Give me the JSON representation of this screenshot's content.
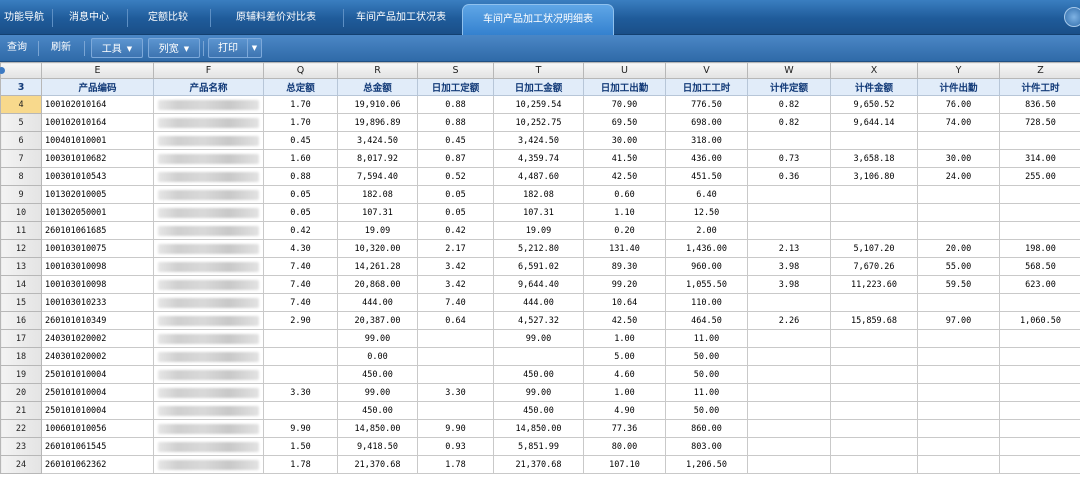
{
  "tabs": [
    {
      "label": "功能导航",
      "active": false
    },
    {
      "label": "消息中心",
      "active": false
    },
    {
      "label": "定额比较",
      "active": false
    },
    {
      "label": "原辅料差价对比表",
      "active": false
    },
    {
      "label": "车间产品加工状况表",
      "active": false
    },
    {
      "label": "车间产品加工状况明细表",
      "active": true
    }
  ],
  "toolbar": {
    "query_label": "查询",
    "refresh_label": "刷新",
    "tools_label": "工具",
    "colwidth_label": "列宽",
    "print_label": "打印"
  },
  "grid": {
    "column_letters": [
      "E",
      "F",
      "Q",
      "R",
      "S",
      "T",
      "U",
      "V",
      "W",
      "X",
      "Y",
      "Z"
    ],
    "header_row_number": "3",
    "headers": [
      "产品编码",
      "产品名称",
      "总定额",
      "总金额",
      "日加工定额",
      "日加工金额",
      "日加工出勤",
      "日加工工时",
      "计件定额",
      "计件金额",
      "计件出勤",
      "计件工时"
    ],
    "selected_row": "4",
    "rows": [
      {
        "n": "4",
        "code": "100102010164",
        "q": "1.70",
        "r": "19,910.06",
        "s": "0.88",
        "t": "10,259.54",
        "u": "70.90",
        "v": "776.50",
        "w": "0.82",
        "x": "9,650.52",
        "y": "76.00",
        "z": "836.50"
      },
      {
        "n": "5",
        "code": "100102010164",
        "q": "1.70",
        "r": "19,896.89",
        "s": "0.88",
        "t": "10,252.75",
        "u": "69.50",
        "v": "698.00",
        "w": "0.82",
        "x": "9,644.14",
        "y": "74.00",
        "z": "728.50"
      },
      {
        "n": "6",
        "code": "100401010001",
        "q": "0.45",
        "r": "3,424.50",
        "s": "0.45",
        "t": "3,424.50",
        "u": "30.00",
        "v": "318.00",
        "w": "",
        "x": "",
        "y": "",
        "z": ""
      },
      {
        "n": "7",
        "code": "100301010682",
        "q": "1.60",
        "r": "8,017.92",
        "s": "0.87",
        "t": "4,359.74",
        "u": "41.50",
        "v": "436.00",
        "w": "0.73",
        "x": "3,658.18",
        "y": "30.00",
        "z": "314.00"
      },
      {
        "n": "8",
        "code": "100301010543",
        "q": "0.88",
        "r": "7,594.40",
        "s": "0.52",
        "t": "4,487.60",
        "u": "42.50",
        "v": "451.50",
        "w": "0.36",
        "x": "3,106.80",
        "y": "24.00",
        "z": "255.00"
      },
      {
        "n": "9",
        "code": "101302010005",
        "q": "0.05",
        "r": "182.08",
        "s": "0.05",
        "t": "182.08",
        "u": "0.60",
        "v": "6.40",
        "w": "",
        "x": "",
        "y": "",
        "z": ""
      },
      {
        "n": "10",
        "code": "101302050001",
        "q": "0.05",
        "r": "107.31",
        "s": "0.05",
        "t": "107.31",
        "u": "1.10",
        "v": "12.50",
        "w": "",
        "x": "",
        "y": "",
        "z": ""
      },
      {
        "n": "11",
        "code": "260101061685",
        "q": "0.42",
        "r": "19.09",
        "s": "0.42",
        "t": "19.09",
        "u": "0.20",
        "v": "2.00",
        "w": "",
        "x": "",
        "y": "",
        "z": ""
      },
      {
        "n": "12",
        "code": "100103010075",
        "q": "4.30",
        "r": "10,320.00",
        "s": "2.17",
        "t": "5,212.80",
        "u": "131.40",
        "v": "1,436.00",
        "w": "2.13",
        "x": "5,107.20",
        "y": "20.00",
        "z": "198.00"
      },
      {
        "n": "13",
        "code": "100103010098",
        "q": "7.40",
        "r": "14,261.28",
        "s": "3.42",
        "t": "6,591.02",
        "u": "89.30",
        "v": "960.00",
        "w": "3.98",
        "x": "7,670.26",
        "y": "55.00",
        "z": "568.50"
      },
      {
        "n": "14",
        "code": "100103010098",
        "q": "7.40",
        "r": "20,868.00",
        "s": "3.42",
        "t": "9,644.40",
        "u": "99.20",
        "v": "1,055.50",
        "w": "3.98",
        "x": "11,223.60",
        "y": "59.50",
        "z": "623.00"
      },
      {
        "n": "15",
        "code": "100103010233",
        "q": "7.40",
        "r": "444.00",
        "s": "7.40",
        "t": "444.00",
        "u": "10.64",
        "v": "110.00",
        "w": "",
        "x": "",
        "y": "",
        "z": ""
      },
      {
        "n": "16",
        "code": "260101010349",
        "q": "2.90",
        "r": "20,387.00",
        "s": "0.64",
        "t": "4,527.32",
        "u": "42.50",
        "v": "464.50",
        "w": "2.26",
        "x": "15,859.68",
        "y": "97.00",
        "z": "1,060.50"
      },
      {
        "n": "17",
        "code": "240301020002",
        "q": "",
        "r": "99.00",
        "s": "",
        "t": "99.00",
        "u": "1.00",
        "v": "11.00",
        "w": "",
        "x": "",
        "y": "",
        "z": ""
      },
      {
        "n": "18",
        "code": "240301020002",
        "q": "",
        "r": "0.00",
        "s": "",
        "t": "",
        "u": "5.00",
        "v": "50.00",
        "w": "",
        "x": "",
        "y": "",
        "z": ""
      },
      {
        "n": "19",
        "code": "250101010004",
        "q": "",
        "r": "450.00",
        "s": "",
        "t": "450.00",
        "u": "4.60",
        "v": "50.00",
        "w": "",
        "x": "",
        "y": "",
        "z": ""
      },
      {
        "n": "20",
        "code": "250101010004",
        "q": "3.30",
        "r": "99.00",
        "s": "3.30",
        "t": "99.00",
        "u": "1.00",
        "v": "11.00",
        "w": "",
        "x": "",
        "y": "",
        "z": ""
      },
      {
        "n": "21",
        "code": "250101010004",
        "q": "",
        "r": "450.00",
        "s": "",
        "t": "450.00",
        "u": "4.90",
        "v": "50.00",
        "w": "",
        "x": "",
        "y": "",
        "z": ""
      },
      {
        "n": "22",
        "code": "100601010056",
        "q": "9.90",
        "r": "14,850.00",
        "s": "9.90",
        "t": "14,850.00",
        "u": "77.36",
        "v": "860.00",
        "w": "",
        "x": "",
        "y": "",
        "z": ""
      },
      {
        "n": "23",
        "code": "260101061545",
        "q": "1.50",
        "r": "9,418.50",
        "s": "0.93",
        "t": "5,851.99",
        "u": "80.00",
        "v": "803.00",
        "w": "",
        "x": "",
        "y": "",
        "z": ""
      },
      {
        "n": "24",
        "code": "260101062362",
        "q": "1.78",
        "r": "21,370.68",
        "s": "1.78",
        "t": "21,370.68",
        "u": "107.10",
        "v": "1,206.50",
        "w": "",
        "x": "",
        "y": "",
        "z": ""
      }
    ]
  }
}
